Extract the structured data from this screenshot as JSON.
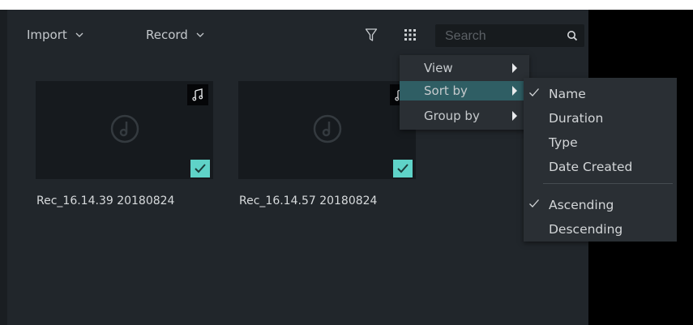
{
  "toolbar": {
    "import_label": "Import",
    "record_label": "Record",
    "filter_icon": "filter-icon",
    "grid_icon": "grid-view-icon",
    "search_placeholder": "Search",
    "search_icon": "search-icon"
  },
  "clips": [
    {
      "label": "Rec_16.14.39 20180824",
      "selected": true
    },
    {
      "label": "Rec_16.14.57 20180824",
      "selected": true
    }
  ],
  "view_menu": {
    "items": [
      {
        "label": "View"
      },
      {
        "label": "Sort by"
      },
      {
        "label": "Group by"
      }
    ],
    "highlighted": "Sort by"
  },
  "sort_menu": {
    "fields": [
      {
        "label": "Name",
        "checked": true
      },
      {
        "label": "Duration",
        "checked": false
      },
      {
        "label": "Type",
        "checked": false
      },
      {
        "label": "Date Created",
        "checked": false
      }
    ],
    "order": [
      {
        "label": "Ascending",
        "checked": true
      },
      {
        "label": "Descending",
        "checked": false
      }
    ]
  },
  "colors": {
    "accent": "#5fd3c8",
    "menu_highlight": "#2f5e64",
    "panel": "#21262b"
  }
}
